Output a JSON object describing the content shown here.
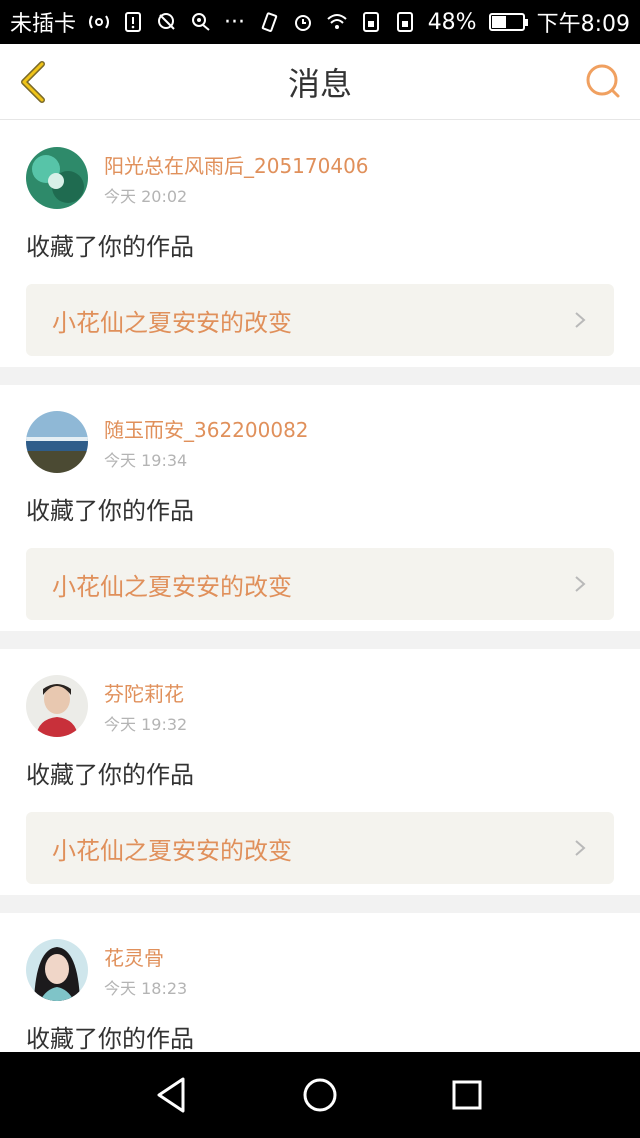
{
  "status": {
    "carrier": "未插卡",
    "more": "···",
    "battery_percent": "48%",
    "battery_level": 0.48,
    "time": "下午8:09"
  },
  "header": {
    "title": "消息",
    "back_icon": "chevron-left-icon",
    "search_icon": "search-icon",
    "accent_color": "#e0905b"
  },
  "messages": [
    {
      "username": "阳光总在风雨后_205170406",
      "time": "今天 20:02",
      "action": "收藏了你的作品",
      "work_title": "小花仙之夏安安的改变"
    },
    {
      "username": "随玉而安_362200082",
      "time": "今天 19:34",
      "action": "收藏了你的作品",
      "work_title": "小花仙之夏安安的改变"
    },
    {
      "username": "芬陀莉花",
      "time": "今天 19:32",
      "action": "收藏了你的作品",
      "work_title": "小花仙之夏安安的改变"
    },
    {
      "username": "花灵骨",
      "time": "今天 18:23",
      "action": "收藏了你的作品",
      "work_title": ""
    }
  ]
}
